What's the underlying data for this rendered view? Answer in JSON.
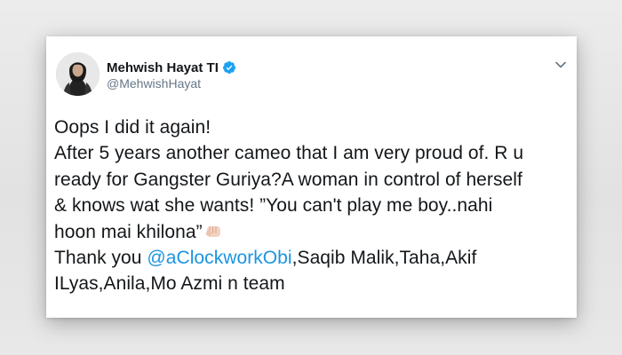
{
  "tweet": {
    "author": {
      "display_name": "Mehwish Hayat TI",
      "handle": "@MehwishHayat",
      "verified": true
    },
    "lines": [
      "Oops I did it again!",
      "After 5 years another cameo that I am very proud of. R u",
      "ready for Gangster Guriya?A woman in control of herself",
      "& knows wat she wants! ”You can't play me boy..nahi",
      "hoon mai khilona”"
    ],
    "thanks_prefix": "Thank you ",
    "mention": "@aClockworkObi",
    "thanks_suffix": ",Saqib Malik,Taha,Akif",
    "last_line": "ILyas,Anila,Mo Azmi n team",
    "emoji": "fist-emoji"
  },
  "colors": {
    "accent": "#1b95e0",
    "text": "#14171a",
    "muted": "#657786",
    "verified": "#1da1f2"
  },
  "icons": {
    "verified": "verified-badge-icon",
    "menu": "chevron-down-icon"
  }
}
